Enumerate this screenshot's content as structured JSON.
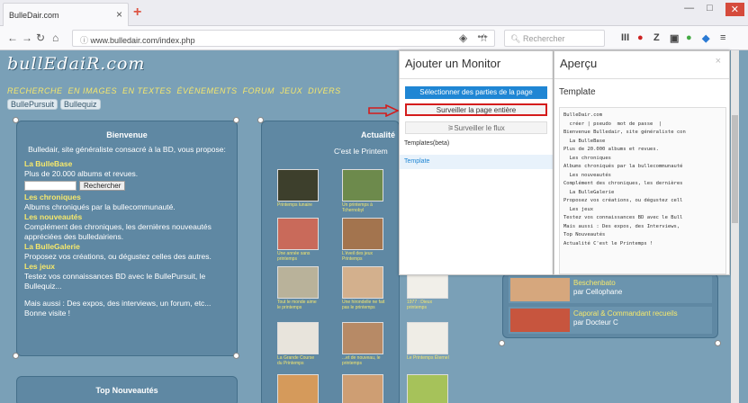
{
  "browser": {
    "tab_title": "BulleDair.com",
    "tab_close": "×",
    "new_tab": "+",
    "url": "www.bulledair.com/index.php",
    "url_dots": "•••",
    "search_placeholder": "Rechercher"
  },
  "page": {
    "logo": "bullEdaiR.com",
    "menu": [
      "RECHERCHE",
      "EN IMAGES",
      "EN TEXTES",
      "ÉVÈNEMENTS",
      "FORUM",
      "JEUX",
      "DIVERS"
    ],
    "chips": [
      "BullePursuit",
      "Bullequiz"
    ],
    "welcome": {
      "title": "Bienvenue",
      "intro": "Bulledair, site généraliste consacré à la BD, vous propose:",
      "s1": "La BulleBase",
      "s1t": "Plus de 20.000 albums et revues.",
      "search_btn": "Rechercher",
      "s2": "Les chroniques",
      "s2t": "Albums chroniqués par la bullecommunauté.",
      "s3": "Les nouveautés",
      "s3t": "Complément des chroniques, les dernières nouveautés appréciées des bulledairiens.",
      "s4": "La BulleGalerie",
      "s4t": "Proposez vos créations, ou dégustez celles des autres.",
      "s5": "Les jeux",
      "s5t": "Testez vos connaissances BD avec le BullePursuit, le Bullequiz...",
      "s6t": "Mais aussi : Des expos, des interviews, un forum, etc... Bonne visite !"
    },
    "news": {
      "title": "Top Nouveautés"
    },
    "actu": {
      "title": "Actualité",
      "sub": "C'est le Printem"
    },
    "thumb_captions": [
      "Printemps lunaire",
      "Un printemps à Tchernobyl",
      "Une année sans printemps",
      "L'éveil des jeux Printemps",
      "Tout le monde aime le printemps",
      "Une hirondelle ne fait pas le printemps",
      "1977 : Dieux printemps",
      "La Grande Course du Printemps",
      "...et de nouveau, le printemps",
      "Le Printemps Éternel"
    ],
    "right_items": [
      {
        "title": "Beschenbato",
        "by": "par Cellophane"
      },
      {
        "title": "Caporal & Commandant recueils",
        "by": "par Docteur C"
      }
    ]
  },
  "monitor": {
    "title": "Ajouter un Monitor",
    "btn_select": "Sélectionner des parties de la page",
    "btn_whole": "Surveiller la page entière",
    "btn_feed": "Surveiller le flux",
    "templates_label": "Templates(beta)",
    "template_item": "Template"
  },
  "preview": {
    "title": "Aperçu",
    "close": "×",
    "subtitle": "Template",
    "lines": [
      "BulleDair.com",
      "  créer | pseudo  mot de passe  |",
      "Bienvenue Bulledair, site généraliste con",
      "  La BulleBase",
      "Plus de 20.000 albums et revues.",
      "  Les chroniques",
      "Albums chroniqués par la bullecommunauté",
      "  Les nouveautés",
      "Complément des chroniques, les dernières",
      "  La BulleGalerie",
      "Proposez vos créations, ou dégustez cell",
      "  Les jeux",
      "Testez vos connaissances BD avec le Bull",
      "Mais aussi : Des expos, des Interviews,",
      "Top Nouveautés",
      "Actualité C'est le Printemps !"
    ]
  }
}
